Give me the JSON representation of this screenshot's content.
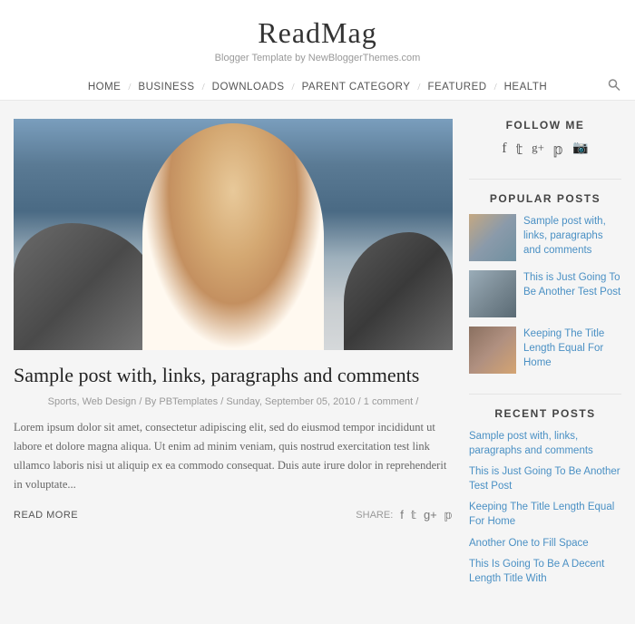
{
  "header": {
    "title": "ReadMag",
    "subtitle": "Blogger Template by NewBloggerThemes.com",
    "nav": [
      {
        "label": "HOME"
      },
      {
        "label": "BUSINESS"
      },
      {
        "label": "DOWNLOADS"
      },
      {
        "label": "PARENT CATEGORY"
      },
      {
        "label": "FEATURED"
      },
      {
        "label": "HEALTH"
      }
    ]
  },
  "main": {
    "post": {
      "title": "Sample post with, links, paragraphs and comments",
      "meta": "Sports, Web Design  /  By PBTemplates  /  Sunday, September 05, 2010  /  1 comment  /",
      "excerpt": "Lorem ipsum dolor sit amet, consectetur adipiscing elit, sed do eiusmod tempor incididunt ut labore et dolore magna aliqua. Ut enim ad minim veniam, quis nostrud exercitation test link ullamco laboris nisi ut aliquip ex ea commodo consequat. Duis aute irure dolor in reprehenderit in voluptate...",
      "read_more": "READ MORE",
      "share_label": "SHARE:"
    }
  },
  "sidebar": {
    "follow_heading": "FOLLOW ME",
    "follow_icons": [
      "f",
      "𝕥",
      "g+",
      "𝕡",
      "📷"
    ],
    "popular_heading": "POPULAR POSTS",
    "popular_posts": [
      {
        "title": "Sample post with, links, paragraphs and comments"
      },
      {
        "title": "This is Just Going To Be Another Test Post"
      },
      {
        "title": "Keeping The Title Length Equal For Home"
      }
    ],
    "recent_heading": "RECENT POSTS",
    "recent_posts": [
      {
        "title": "Sample post with, links, paragraphs and comments"
      },
      {
        "title": "This is Just Going To Be Another Test Post"
      },
      {
        "title": "Keeping The Title Length Equal For Home"
      },
      {
        "title": "Another One to Fill Space"
      },
      {
        "title": "This Is Going To Be A Decent Length Title With"
      }
    ]
  }
}
